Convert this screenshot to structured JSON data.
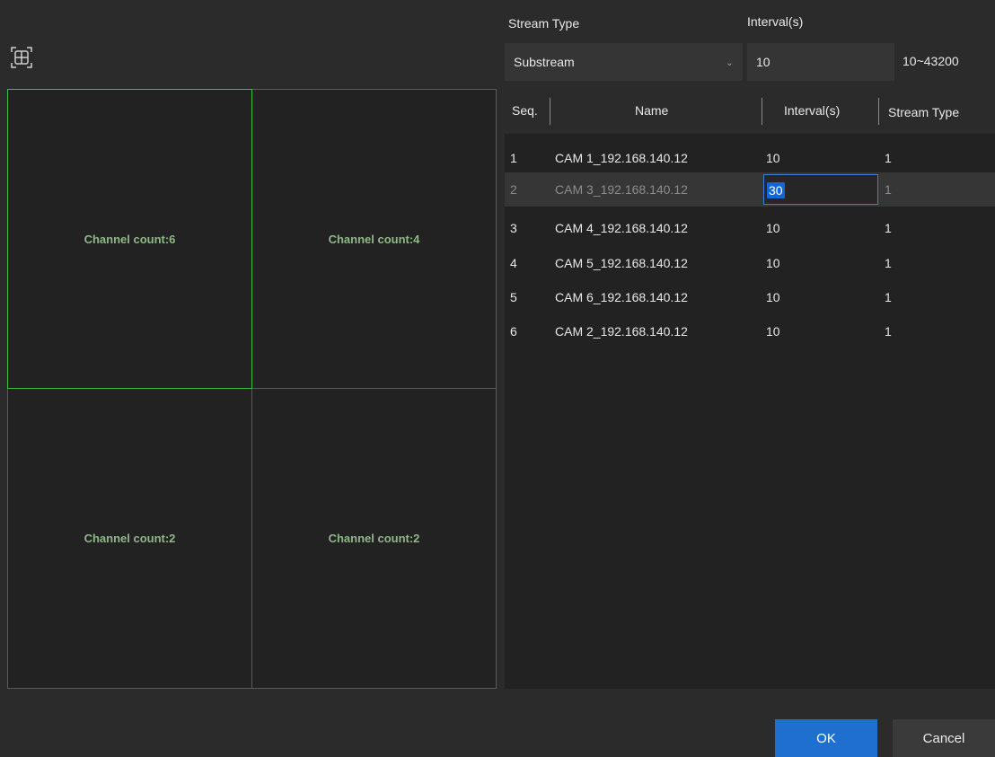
{
  "form": {
    "stream_type_label": "Stream Type",
    "interval_label": "Interval(s)",
    "stream_type_value": "Substream",
    "interval_value": "10",
    "interval_range": "10~43200"
  },
  "grid": {
    "tiles": [
      {
        "label": "Channel count:6",
        "selected": true
      },
      {
        "label": "Channel count:4",
        "selected": false
      },
      {
        "label": "Channel count:2",
        "selected": false
      },
      {
        "label": "Channel count:2",
        "selected": false
      }
    ]
  },
  "table": {
    "headers": [
      "Seq.",
      "Name",
      "Interval(s)",
      "Stream Type"
    ],
    "rows": [
      {
        "seq": "1",
        "name": "CAM 1_192.168.140.12",
        "interval": "10",
        "stream_type": "1"
      },
      {
        "seq": "2",
        "name": "CAM 3_192.168.140.12",
        "interval": "30",
        "stream_type": "1",
        "editing": true
      },
      {
        "seq": "3",
        "name": "CAM 4_192.168.140.12",
        "interval": "10",
        "stream_type": "1"
      },
      {
        "seq": "4",
        "name": "CAM 5_192.168.140.12",
        "interval": "10",
        "stream_type": "1"
      },
      {
        "seq": "5",
        "name": "CAM 6_192.168.140.12",
        "interval": "10",
        "stream_type": "1"
      },
      {
        "seq": "6",
        "name": "CAM 2_192.168.140.12",
        "interval": "10",
        "stream_type": "1"
      }
    ]
  },
  "buttons": {
    "ok": "OK",
    "cancel": "Cancel"
  },
  "icons": {
    "layout": "split-layout-icon",
    "dropdown": "chevron-down-icon"
  },
  "colors": {
    "selected_border": "#38c13a",
    "tile_text": "#8fb787",
    "accent": "#1e6fd0"
  }
}
